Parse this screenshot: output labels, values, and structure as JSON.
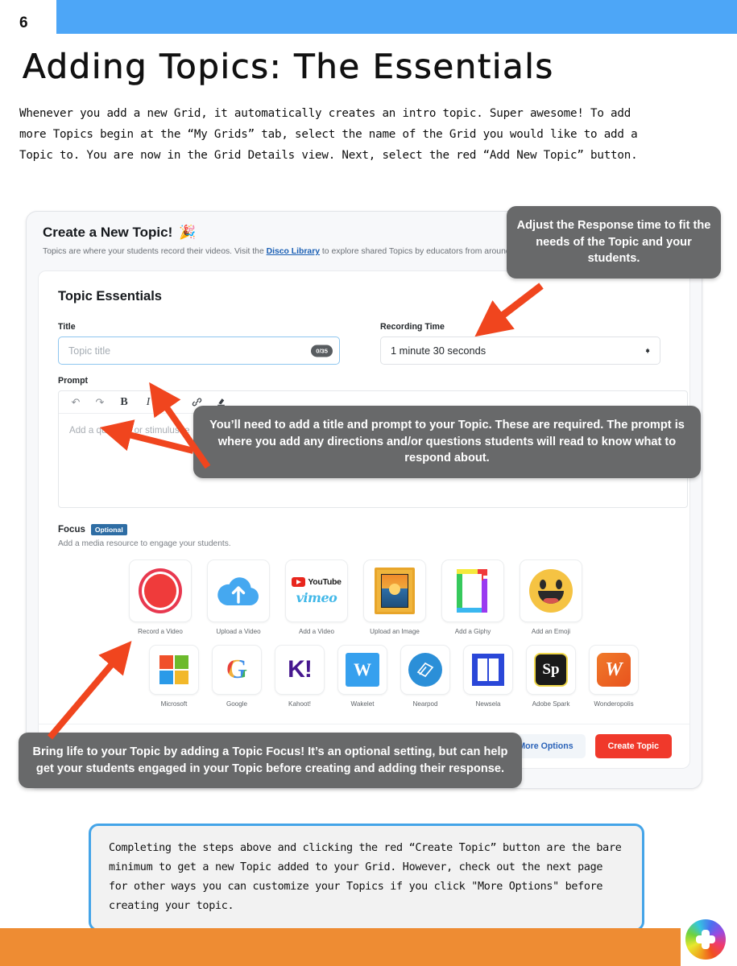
{
  "page": {
    "number": "6",
    "heading": "Adding Topics: The Essentials",
    "intro": "Whenever you add a new Grid, it automatically creates an intro topic. Super awesome! To add more Topics begin at the “My Grids” tab, select the name of the Grid you would like to add a Topic to. You are now in the Grid Details view. Next, select the red “Add New Topic” button.",
    "colors": {
      "top_bar": "#4da6f7",
      "bottom_bar": "#ee8c33",
      "note_border": "#44a4e8",
      "arrow": "#f0451e",
      "callout_bg": "#68696a",
      "create_button": "#f0392b"
    }
  },
  "screenshot": {
    "header": {
      "title": "Create a New Topic!",
      "party_icon": "🎉",
      "subtitle_before": "Topics are where your students record their videos. Visit the ",
      "subtitle_link": "Disco Library",
      "subtitle_after": " to explore shared Topics by educators from around the w"
    },
    "section_title": "Topic Essentials",
    "title_field": {
      "label": "Title",
      "placeholder": "Topic title",
      "value": "",
      "counter": "0/35"
    },
    "recording_time": {
      "label": "Recording Time",
      "value": "1 minute 30 seconds"
    },
    "prompt": {
      "label": "Prompt",
      "placeholder": "Add a question or stimulus te",
      "toolbar": [
        {
          "name": "undo-icon",
          "glyph": "↶"
        },
        {
          "name": "redo-icon",
          "glyph": "↷"
        },
        {
          "name": "bold-icon",
          "glyph": "B"
        },
        {
          "name": "italic-icon",
          "glyph": "I"
        },
        {
          "name": "list-icon",
          "glyph": ""
        },
        {
          "name": "link-icon",
          "glyph": "🔗"
        },
        {
          "name": "eraser-icon",
          "glyph": "✒"
        }
      ]
    },
    "focus": {
      "label": "Focus",
      "badge": "Optional",
      "subtitle": "Add a media resource to engage your students.",
      "row1": [
        {
          "caption": "Record a Video",
          "icon": "record-video-icon"
        },
        {
          "caption": "Upload a Video",
          "icon": "upload-cloud-icon"
        },
        {
          "caption": "Add a Video",
          "icon": "youtube-vimeo-icon"
        },
        {
          "caption": "Upload an Image",
          "icon": "picture-frame-icon"
        },
        {
          "caption": "Add a Giphy",
          "icon": "giphy-icon"
        },
        {
          "caption": "Add an Emoji",
          "icon": "emoji-icon"
        }
      ],
      "row2": [
        {
          "caption": "Microsoft",
          "icon": "microsoft-icon"
        },
        {
          "caption": "Google",
          "icon": "google-icon"
        },
        {
          "caption": "Kahoot!",
          "icon": "kahoot-icon"
        },
        {
          "caption": "Wakelet",
          "icon": "wakelet-icon"
        },
        {
          "caption": "Nearpod",
          "icon": "nearpod-icon"
        },
        {
          "caption": "Newsela",
          "icon": "newsela-icon"
        },
        {
          "caption": "Adobe Spark",
          "icon": "adobe-spark-icon"
        },
        {
          "caption": "Wonderopolis",
          "icon": "wonderopolis-icon"
        }
      ]
    },
    "footer": {
      "more_options": "More Options",
      "create_topic": "Create Topic"
    }
  },
  "callouts": {
    "one": "Adjust the Response time to fit the needs of the Topic and your students.",
    "two": "You’ll need to add a title and prompt to your Topic. These are required. The prompt is where you add any directions and/or questions students will read to know what to respond about.",
    "three": "Bring life to your Topic by adding a Topic Focus! It’s an optional setting, but can help get your students engaged in your Topic before creating and adding their response."
  },
  "note": "Completing the steps above and clicking the red “Create Topic” button are the bare minimum to get a new Topic added to your Grid. However, check out the next page for other ways you can customize your Topics if you click \"More Options\" before creating your topic."
}
